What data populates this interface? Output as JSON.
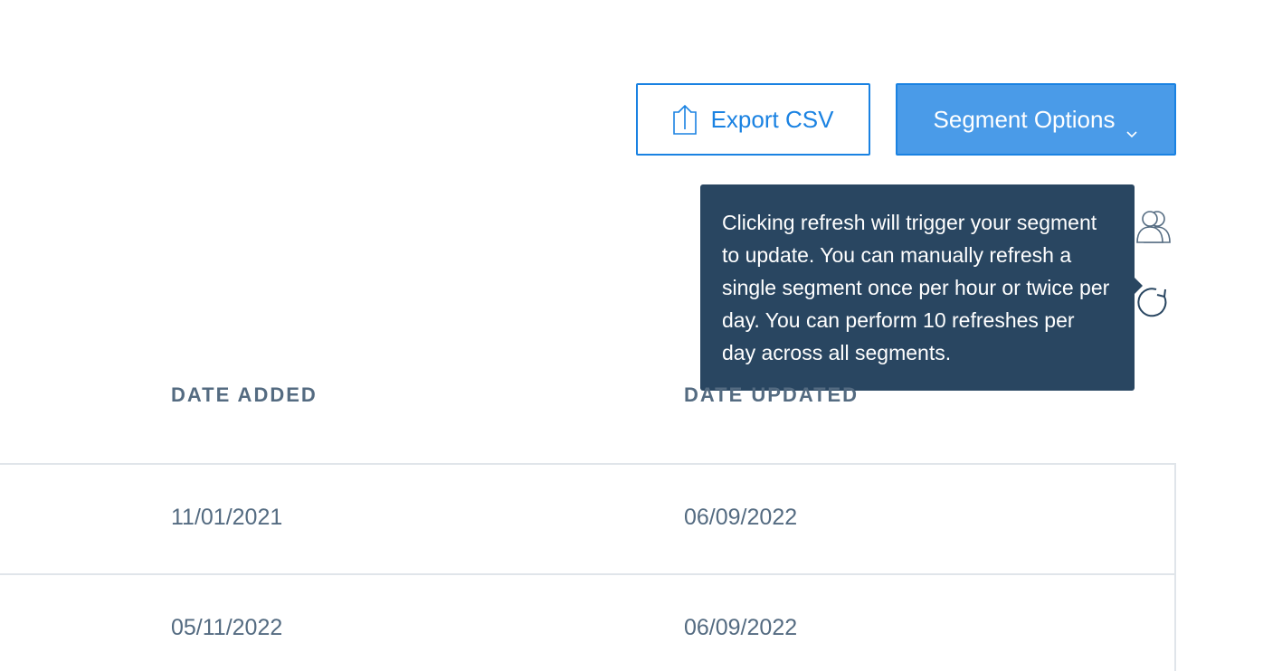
{
  "toolbar": {
    "export_label": "Export CSV",
    "segment_options_label": "Segment Options"
  },
  "tooltip": {
    "text": "Clicking refresh will trigger your segment to update. You can manually refresh a single segment once per hour or twice per day. You can perform 10 refreshes per day across all segments."
  },
  "icons": {
    "export": "upload-icon",
    "segment_chevron": "chevron-down-icon",
    "contacts": "contacts-icon",
    "refresh": "refresh-icon"
  },
  "colors": {
    "accent": "#1a82e2",
    "primary_button": "#4a9be8",
    "tooltip_bg": "#294661",
    "muted_text": "#546b81",
    "border": "#e0e5ea"
  },
  "table": {
    "headers": {
      "date_added": "DATE ADDED",
      "date_updated": "DATE UPDATED"
    },
    "rows": [
      {
        "date_added": "11/01/2021",
        "date_updated": "06/09/2022"
      },
      {
        "date_added": "05/11/2022",
        "date_updated": "06/09/2022"
      }
    ]
  }
}
